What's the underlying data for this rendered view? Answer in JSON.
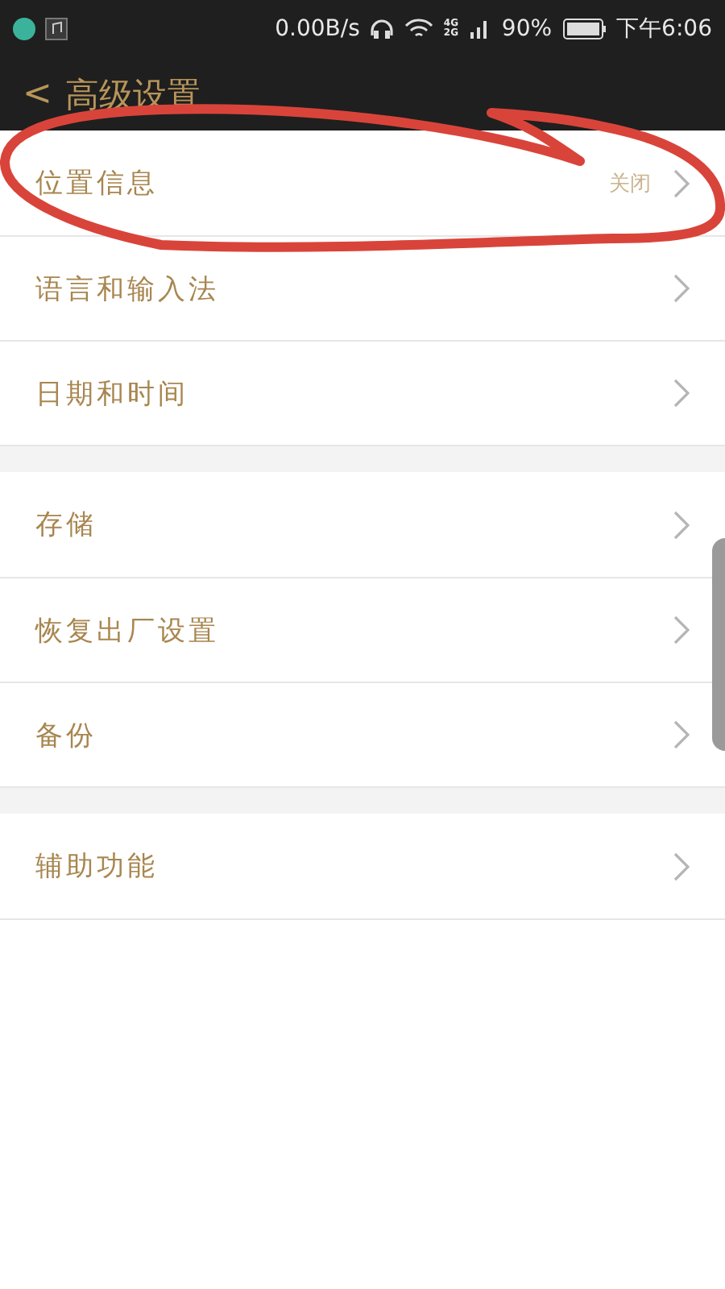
{
  "status_bar": {
    "speed": "0.00B/s",
    "network": "4G 2G",
    "battery": "90%",
    "time": "下午6:06"
  },
  "header": {
    "back": "<",
    "title": "高级设置"
  },
  "sections": [
    {
      "items": [
        {
          "label": "位置信息",
          "value": "关闭"
        },
        {
          "label": "语言和输入法"
        },
        {
          "label": "日期和时间"
        }
      ]
    },
    {
      "items": [
        {
          "label": "存储"
        },
        {
          "label": "恢复出厂设置"
        },
        {
          "label": "备份"
        }
      ]
    },
    {
      "items": [
        {
          "label": "辅助功能"
        }
      ]
    }
  ]
}
